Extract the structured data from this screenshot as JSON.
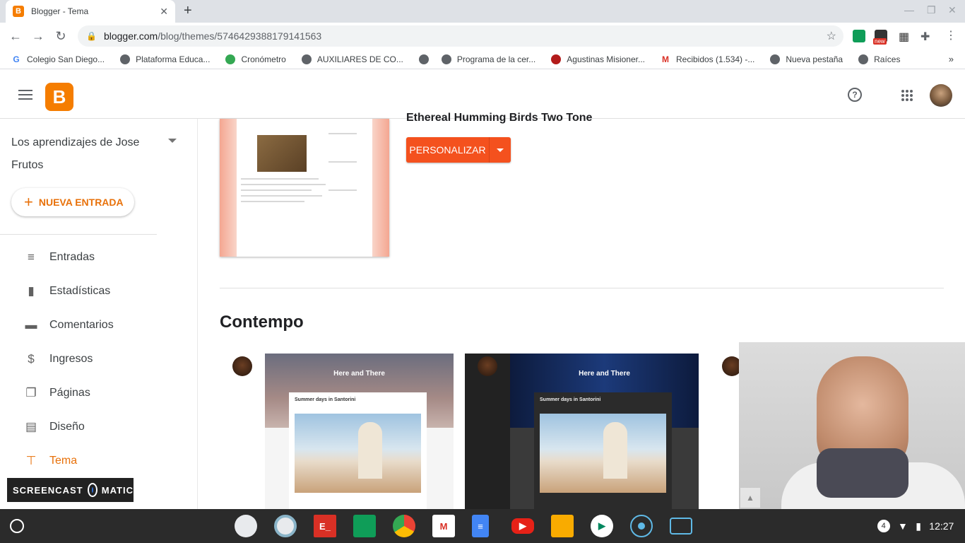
{
  "browser": {
    "tab_title": "Blogger - Tema",
    "tab_close": "✕",
    "new_tab": "+",
    "url_host": "blogger.com",
    "url_path": "/blog/themes/5746429388179141563",
    "ext_badge": "new"
  },
  "bookmarks": [
    {
      "label": "Colegio San Diego...",
      "icon": "G"
    },
    {
      "label": "Plataforma Educa...",
      "icon": ""
    },
    {
      "label": "Cronómetro",
      "icon": ""
    },
    {
      "label": "AUXILIARES DE CO...",
      "icon": ""
    },
    {
      "label": "",
      "icon": ""
    },
    {
      "label": "Programa de la cer...",
      "icon": ""
    },
    {
      "label": "Agustinas Misioner...",
      "icon": ""
    },
    {
      "label": "Recibidos (1.534) -...",
      "icon": "M"
    },
    {
      "label": "Nueva pestaña",
      "icon": ""
    },
    {
      "label": "Raíces",
      "icon": ""
    }
  ],
  "bookmarks_more": "»",
  "app": {
    "logo_letter": "B",
    "help_glyph": "?"
  },
  "sidebar": {
    "blog_name": "Los aprendizajes de Jose Frutos",
    "new_post": "NUEVA ENTRADA",
    "new_post_glyph": "+",
    "items": [
      {
        "label": "Entradas",
        "icon": "≡"
      },
      {
        "label": "Estadísticas",
        "icon": "▮"
      },
      {
        "label": "Comentarios",
        "icon": "▬"
      },
      {
        "label": "Ingresos",
        "icon": "$"
      },
      {
        "label": "Páginas",
        "icon": "❐"
      },
      {
        "label": "Diseño",
        "icon": "▤"
      },
      {
        "label": "Tema",
        "icon": "⊤"
      }
    ]
  },
  "main": {
    "current_theme_name": "Ethereal Humming Birds Two Tone",
    "customize_label": "PERSONALIZAR",
    "section_title": "Contempo",
    "cards": [
      {
        "hero_title": "Here and There",
        "post_title": "Summer days in Santorini"
      },
      {
        "hero_title": "Here and There",
        "post_title": "Summer days in Santorini"
      }
    ]
  },
  "watermark": {
    "left": "SCREENCAST",
    "right": "MATIC"
  },
  "shelf": {
    "notification_count": "4",
    "time": "12:27"
  },
  "colors": {
    "accent": "#e8710a",
    "customize_button": "#f4511e",
    "blogger_orange": "#f57d00"
  }
}
